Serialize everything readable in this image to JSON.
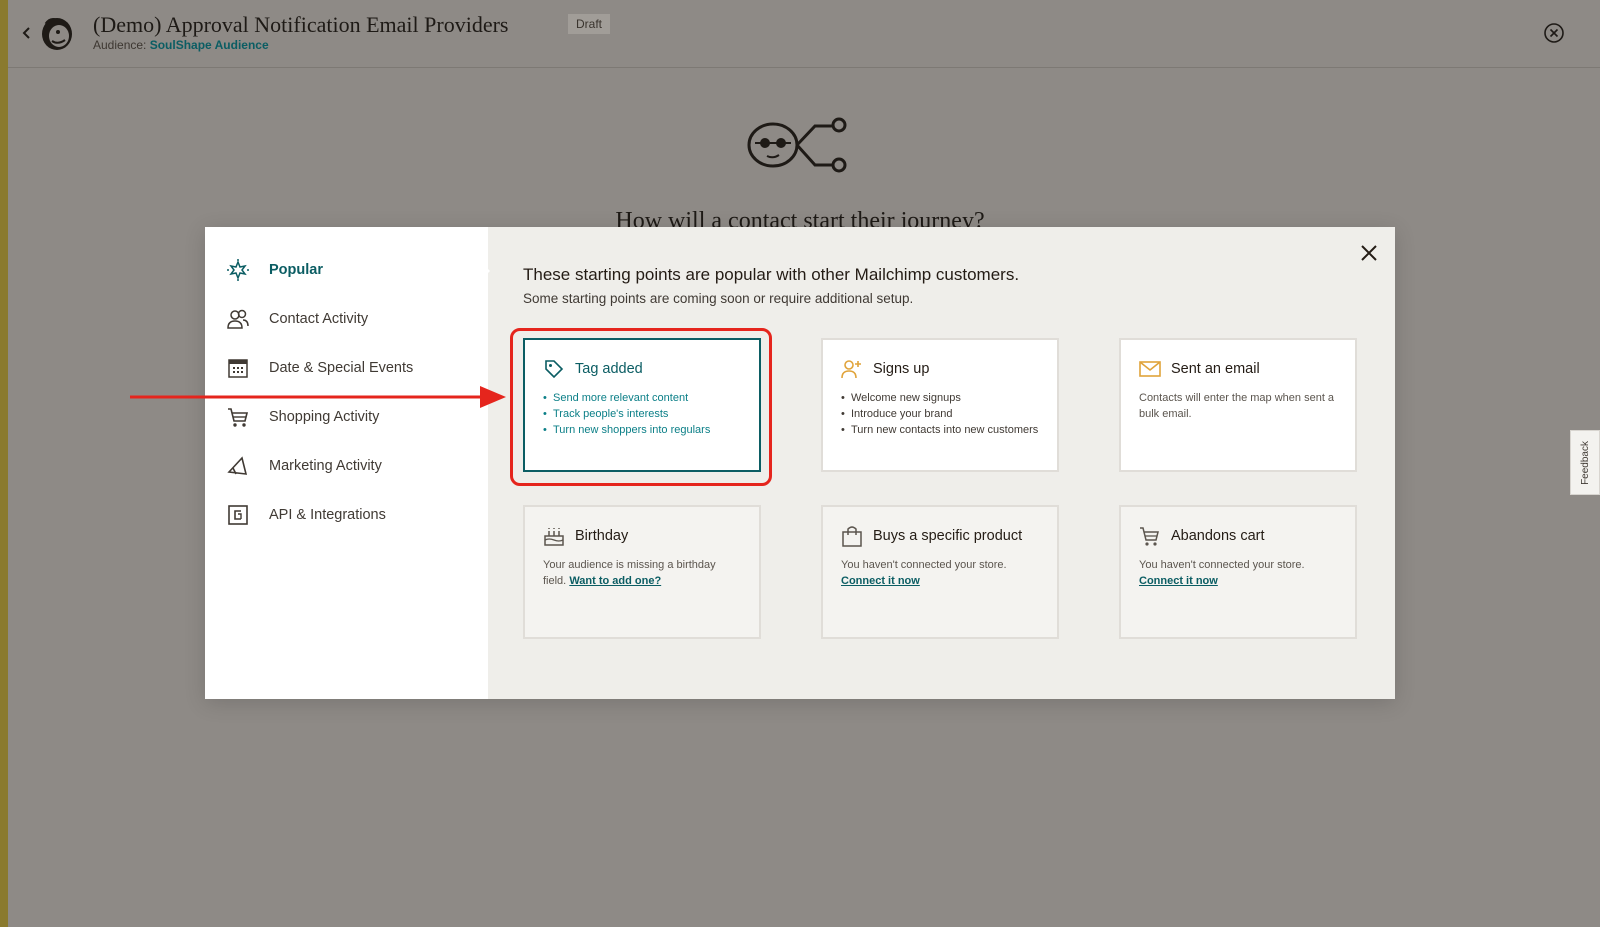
{
  "header": {
    "title": "(Demo) Approval Notification Email Providers",
    "badge": "Draft",
    "audience_label": "Audience:",
    "audience_name": "SoulShape Audience"
  },
  "hero": {
    "question": "How will a contact start their journey?"
  },
  "modal": {
    "intro_title": "These starting points are popular with other Mailchimp customers.",
    "intro_subtitle": "Some starting points are coming soon or require additional setup.",
    "sidebar": [
      {
        "label": "Popular",
        "icon": "sparkle-icon",
        "active": true
      },
      {
        "label": "Contact Activity",
        "icon": "contacts-icon"
      },
      {
        "label": "Date & Special Events",
        "icon": "calendar-icon"
      },
      {
        "label": "Shopping Activity",
        "icon": "cart-icon"
      },
      {
        "label": "Marketing Activity",
        "icon": "megaphone-icon"
      },
      {
        "label": "API & Integrations",
        "icon": "api-icon"
      }
    ],
    "cards": {
      "tag_added": {
        "title": "Tag added",
        "bullets": [
          "Send more relevant content",
          "Track people's interests",
          "Turn new shoppers into regulars"
        ]
      },
      "signs_up": {
        "title": "Signs up",
        "bullets": [
          "Welcome new signups",
          "Introduce your brand",
          "Turn new contacts into new customers"
        ]
      },
      "sent_email": {
        "title": "Sent an email",
        "text": "Contacts will enter the map when sent a bulk email."
      },
      "birthday": {
        "title": "Birthday",
        "text": "Your audience is missing a birthday field.",
        "link": "Want to add one?"
      },
      "buys_product": {
        "title": "Buys a specific product",
        "text": "You haven't connected your store.",
        "link": "Connect it now"
      },
      "abandons_cart": {
        "title": "Abandons cart",
        "text": "You haven't connected your store.",
        "link": "Connect it now"
      }
    }
  },
  "feedback": "Feedback",
  "colors": {
    "accent": "#0b5d63",
    "highlight": "#e5251d",
    "overlay": "#8e8a86"
  }
}
